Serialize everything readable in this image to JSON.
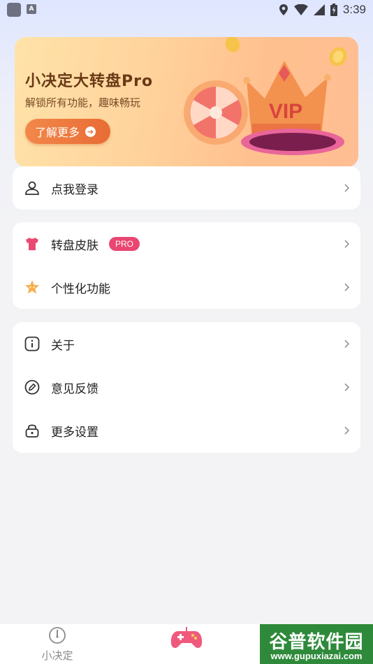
{
  "status_bar": {
    "time": "3:39",
    "app_badge": "A"
  },
  "vip_banner": {
    "title": "小决定大转盘Pro",
    "subtitle": "解锁所有功能，趣味畅玩",
    "button_label": "了解更多",
    "art_text": "VIP",
    "colors": {
      "button": "#e86c35",
      "title": "#6a3a16"
    }
  },
  "login": {
    "label": "点我登录",
    "icon": "user-icon"
  },
  "features": [
    {
      "label": "转盘皮肤",
      "icon": "tshirt-icon",
      "badge": "PRO"
    },
    {
      "label": "个性化功能",
      "icon": "star-icon"
    }
  ],
  "settings": [
    {
      "label": "关于",
      "icon": "info-icon"
    },
    {
      "label": "意见反馈",
      "icon": "edit-icon"
    },
    {
      "label": "更多设置",
      "icon": "lock-icon"
    }
  ],
  "bottom_nav": {
    "items": [
      {
        "label": "小决定",
        "icon": "compass-icon"
      },
      {
        "label": "",
        "icon": "gamepad-icon"
      }
    ]
  },
  "watermark": {
    "line1": "谷普软件园",
    "line2": "www.gupuxiazai.com"
  },
  "colors": {
    "accent": "#e94672",
    "background": "#f3f3f5",
    "card": "#ffffff"
  }
}
